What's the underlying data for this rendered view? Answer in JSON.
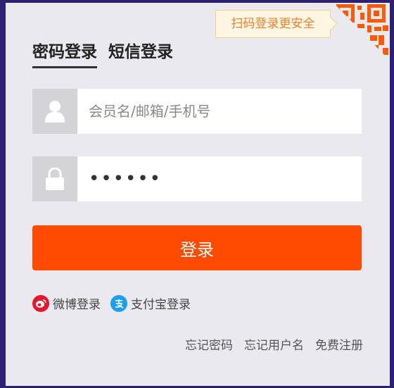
{
  "qr_tip": {
    "label": "扫码登录更安全"
  },
  "tabs": [
    {
      "label": "密码登录",
      "active": true
    },
    {
      "label": "短信登录",
      "active": false
    }
  ],
  "username": {
    "placeholder": "会员名/邮箱/手机号",
    "value": ""
  },
  "password": {
    "value": "••••••"
  },
  "login_button": {
    "label": "登录"
  },
  "social": [
    {
      "label": "微博登录",
      "icon": "weibo-icon",
      "color": "#e6162d"
    },
    {
      "label": "支付宝登录",
      "icon": "alipay-icon",
      "color": "#1a9ff5"
    }
  ],
  "links": {
    "forgot_password": "忘记密码",
    "forgot_username": "忘记用户名",
    "register": "免费注册"
  },
  "colors": {
    "accent": "#ff4a00",
    "qr": "#ff5a00",
    "tip_text": "#f0812d"
  }
}
